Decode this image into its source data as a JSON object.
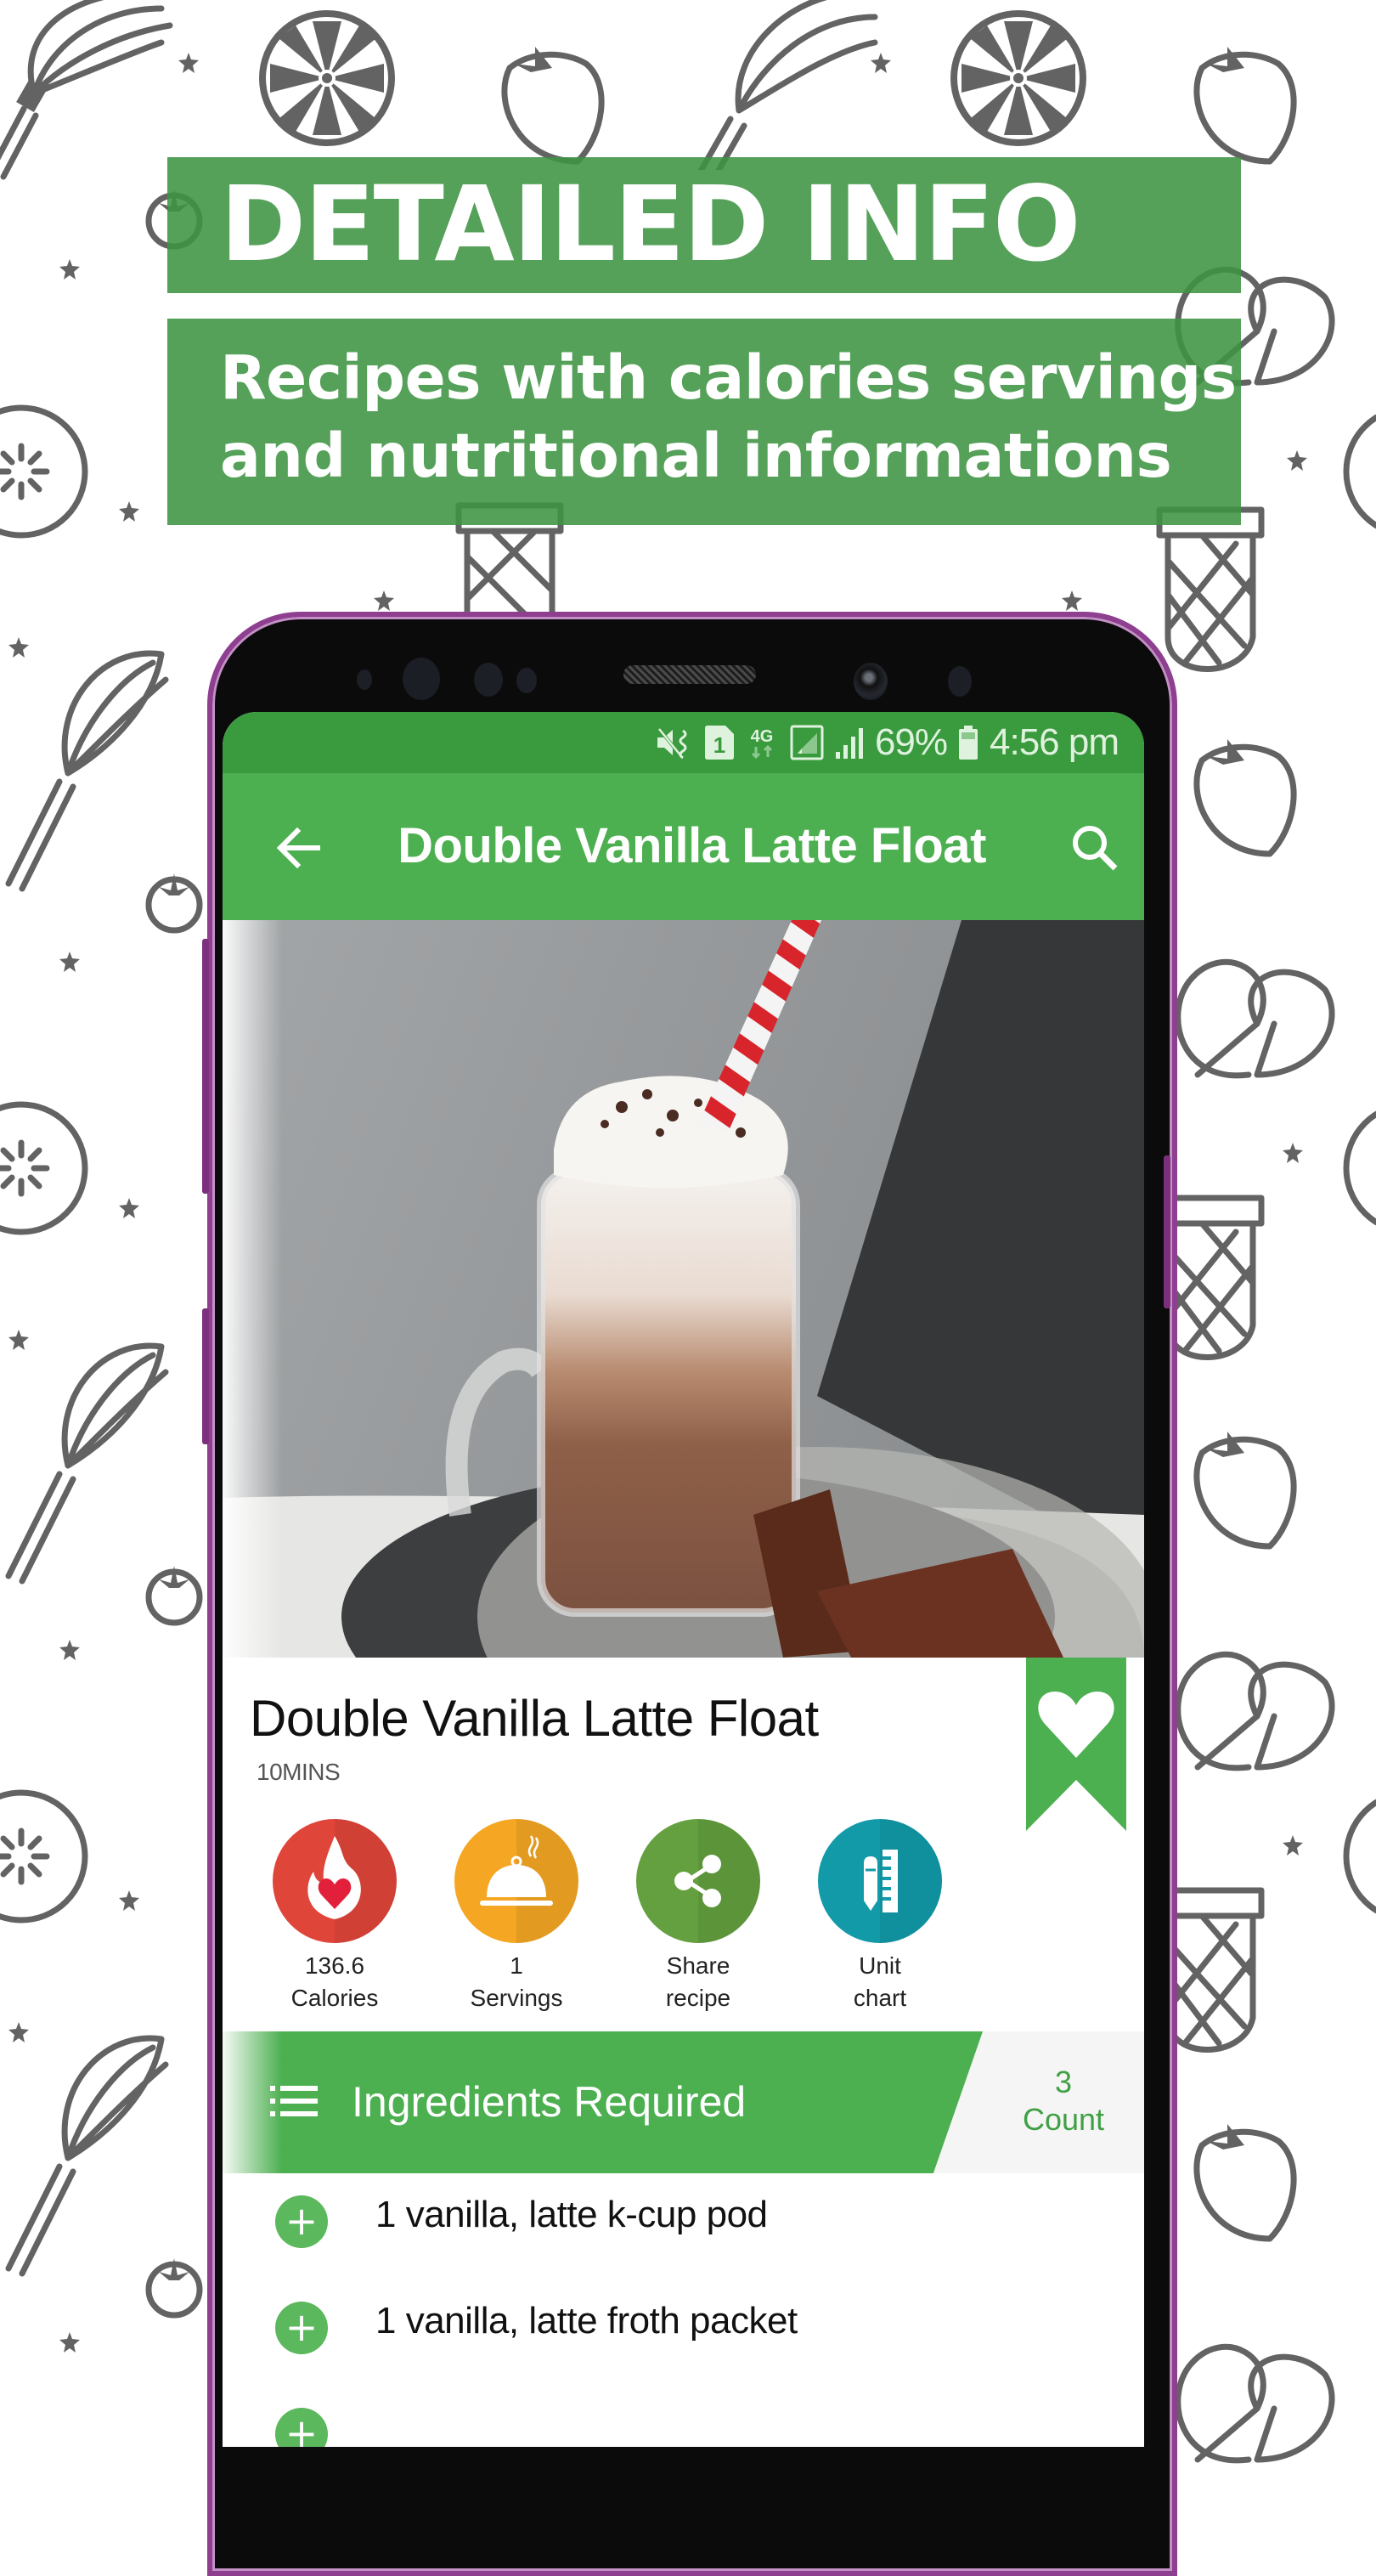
{
  "promo": {
    "headline": "DETAILED INFO",
    "subline_1": "Recipes with calories servings",
    "subline_2": "and nutritional informations"
  },
  "statusbar": {
    "icons": [
      "mute-vibrate-icon",
      "sim-1-icon",
      "4g-data-icon",
      "wifi-signal-box-icon",
      "cell-signal-icon",
      "battery-icon"
    ],
    "network": "4G",
    "sim": "1",
    "battery": "69%",
    "time": "4:56 pm"
  },
  "appbar": {
    "title": "Double Vanilla Latte Float",
    "back_icon": "arrow-left-icon",
    "search_icon": "search-icon"
  },
  "recipe": {
    "photo_alt": "Iced chocolate latte float in mason jar mug with whipped cream, red striped straw and chocolate squares",
    "title": "Double Vanilla Latte Float",
    "time": "10MINS",
    "favorite_icon": "bookmark-heart-icon",
    "stats": [
      {
        "icon": "flame-heart-icon",
        "line1": "136.6",
        "line2": "Calories",
        "color": "#e0453a"
      },
      {
        "icon": "serving-cloche-icon",
        "line1": "1",
        "line2": "Servings",
        "color": "#f5a623"
      },
      {
        "icon": "share-icon",
        "line1": "Share",
        "line2": "recipe",
        "color": "#64a03f"
      },
      {
        "icon": "ruler-pencil-icon",
        "line1": "Unit",
        "line2": "chart",
        "color": "#129aa8"
      }
    ]
  },
  "ingredients": {
    "header": "Ingredients Required",
    "count_value": "3",
    "count_label": "Count",
    "items": [
      {
        "text": "1 vanilla, latte k-cup pod"
      },
      {
        "text": "1 vanilla, latte froth packet"
      },
      {
        "text": ""
      }
    ]
  },
  "colors": {
    "primary_green": "#4caf50",
    "status_green": "#3a9a3e",
    "banner_green": "#3e9442",
    "phone_frame": "#8e3f8f"
  }
}
